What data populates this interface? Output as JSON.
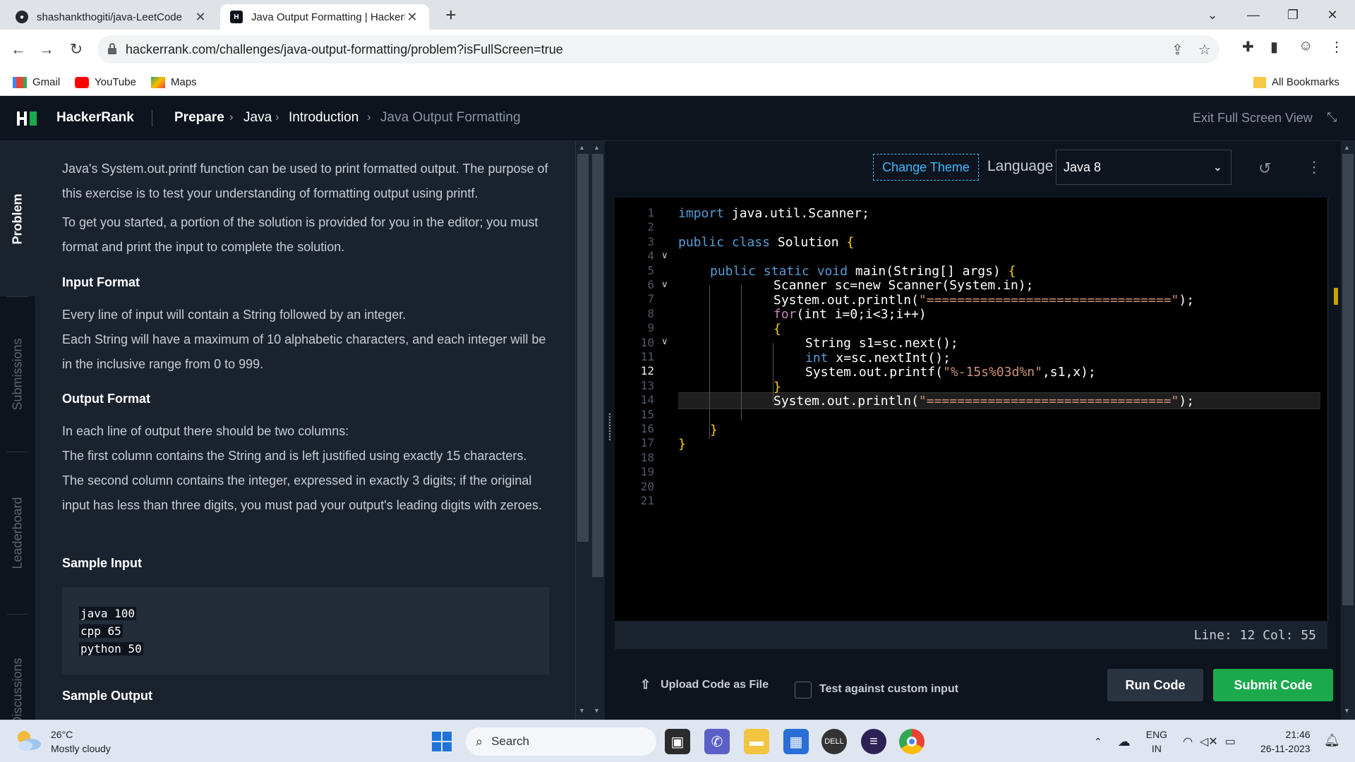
{
  "browser": {
    "tabs": [
      {
        "title": "shashankthogiti/java-LeetCode",
        "icon": "github-icon"
      },
      {
        "title": "Java Output Formatting | HackerRank",
        "icon": "hackerrank-icon"
      }
    ],
    "url": "hackerrank.com/challenges/java-output-formatting/problem?isFullScreen=true",
    "bookmarks": [
      {
        "label": "Gmail",
        "icon": "gmail-icon"
      },
      {
        "label": "YouTube",
        "icon": "youtube-icon"
      },
      {
        "label": "Maps",
        "icon": "maps-icon"
      }
    ],
    "all_bookmarks": "All Bookmarks"
  },
  "header": {
    "logo": "HackerRank",
    "breadcrumb": [
      "Prepare",
      "Java",
      "Introduction",
      "Java Output Formatting"
    ],
    "exit_fullscreen": "Exit Full Screen View"
  },
  "rail": {
    "tabs": [
      "Problem",
      "Submissions",
      "Leaderboard",
      "Discussions"
    ]
  },
  "problem": {
    "intro1": "Java's System.out.printf function can be used to print formatted output. The purpose of this exercise is to test your understanding of formatting output using printf.",
    "intro2": "To get you started, a portion of the solution is provided for you in the editor; you must format and print the input to complete the solution.",
    "input_heading": "Input Format",
    "input_p1": "Every line of input will contain a String followed by an integer.",
    "input_p2": "Each String will have a maximum of 10 alphabetic characters, and each integer will be in the inclusive range from 0 to 999.",
    "output_heading": "Output Format",
    "output_p1": "In each line of output there should be two columns:",
    "output_p2": "The first column contains the String and is left justified using exactly 15 characters.",
    "output_p3": "The second column contains the integer, expressed in exactly 3 digits; if the original input has less than three digits, you must pad your output's leading digits with zeroes.",
    "sample_input_heading": "Sample Input",
    "sample_input": [
      "java 100",
      "cpp 65",
      "python 50"
    ],
    "sample_output_heading": "Sample Output"
  },
  "editor": {
    "change_theme": "Change Theme",
    "language_label": "Language",
    "language_value": "Java 8",
    "line_numbers": [
      "1",
      "2",
      "3",
      "4",
      "5",
      "6",
      "7",
      "8",
      "9",
      "10",
      "11",
      "12",
      "13",
      "14",
      "15",
      "16",
      "17",
      "18",
      "19",
      "20",
      "21"
    ],
    "current_line": "12",
    "code": {
      "l1_kw": "import",
      "l1_rest": " java.util.Scanner;",
      "l3_kw": "public class",
      "l3_rest": " Solution ",
      "l3_br": "{",
      "l5_kw": "public static void",
      "l5_rest": " main(String[] args) ",
      "l5_br": "{",
      "l6": "Scanner sc=new Scanner(System.in);",
      "l7_pre": "System.out.println(",
      "l7_str": "\"================================\"",
      "l7_post": ");",
      "l8_kw": "for",
      "l8_rest": "(int i=0;i<3;i++)",
      "l9": "{",
      "l10": "String s1=sc.next();",
      "l11_kw": "int",
      "l11_rest": " x=sc.nextInt();",
      "l12_pre": "System.out.printf(",
      "l12_str": "\"%-15s%03d%n\"",
      "l12_post": ",s1,x);",
      "l13": "}",
      "l14_pre": "System.out.println(",
      "l14_str": "\"================================\"",
      "l14_post": ");",
      "l16": "}",
      "l17": "}"
    },
    "status": "Line: 12 Col: 55",
    "upload": "Upload Code as File",
    "custom_input": "Test against custom input",
    "run": "Run Code",
    "submit": "Submit Code"
  },
  "taskbar": {
    "temp": "26°C",
    "weather": "Mostly cloudy",
    "search": "Search",
    "lang1": "ENG",
    "lang2": "IN",
    "time": "21:46",
    "date": "26-11-2023"
  },
  "colors": {
    "accent_green": "#1ba94c",
    "bg_dark": "#0e141e",
    "panel": "#1a222e"
  }
}
